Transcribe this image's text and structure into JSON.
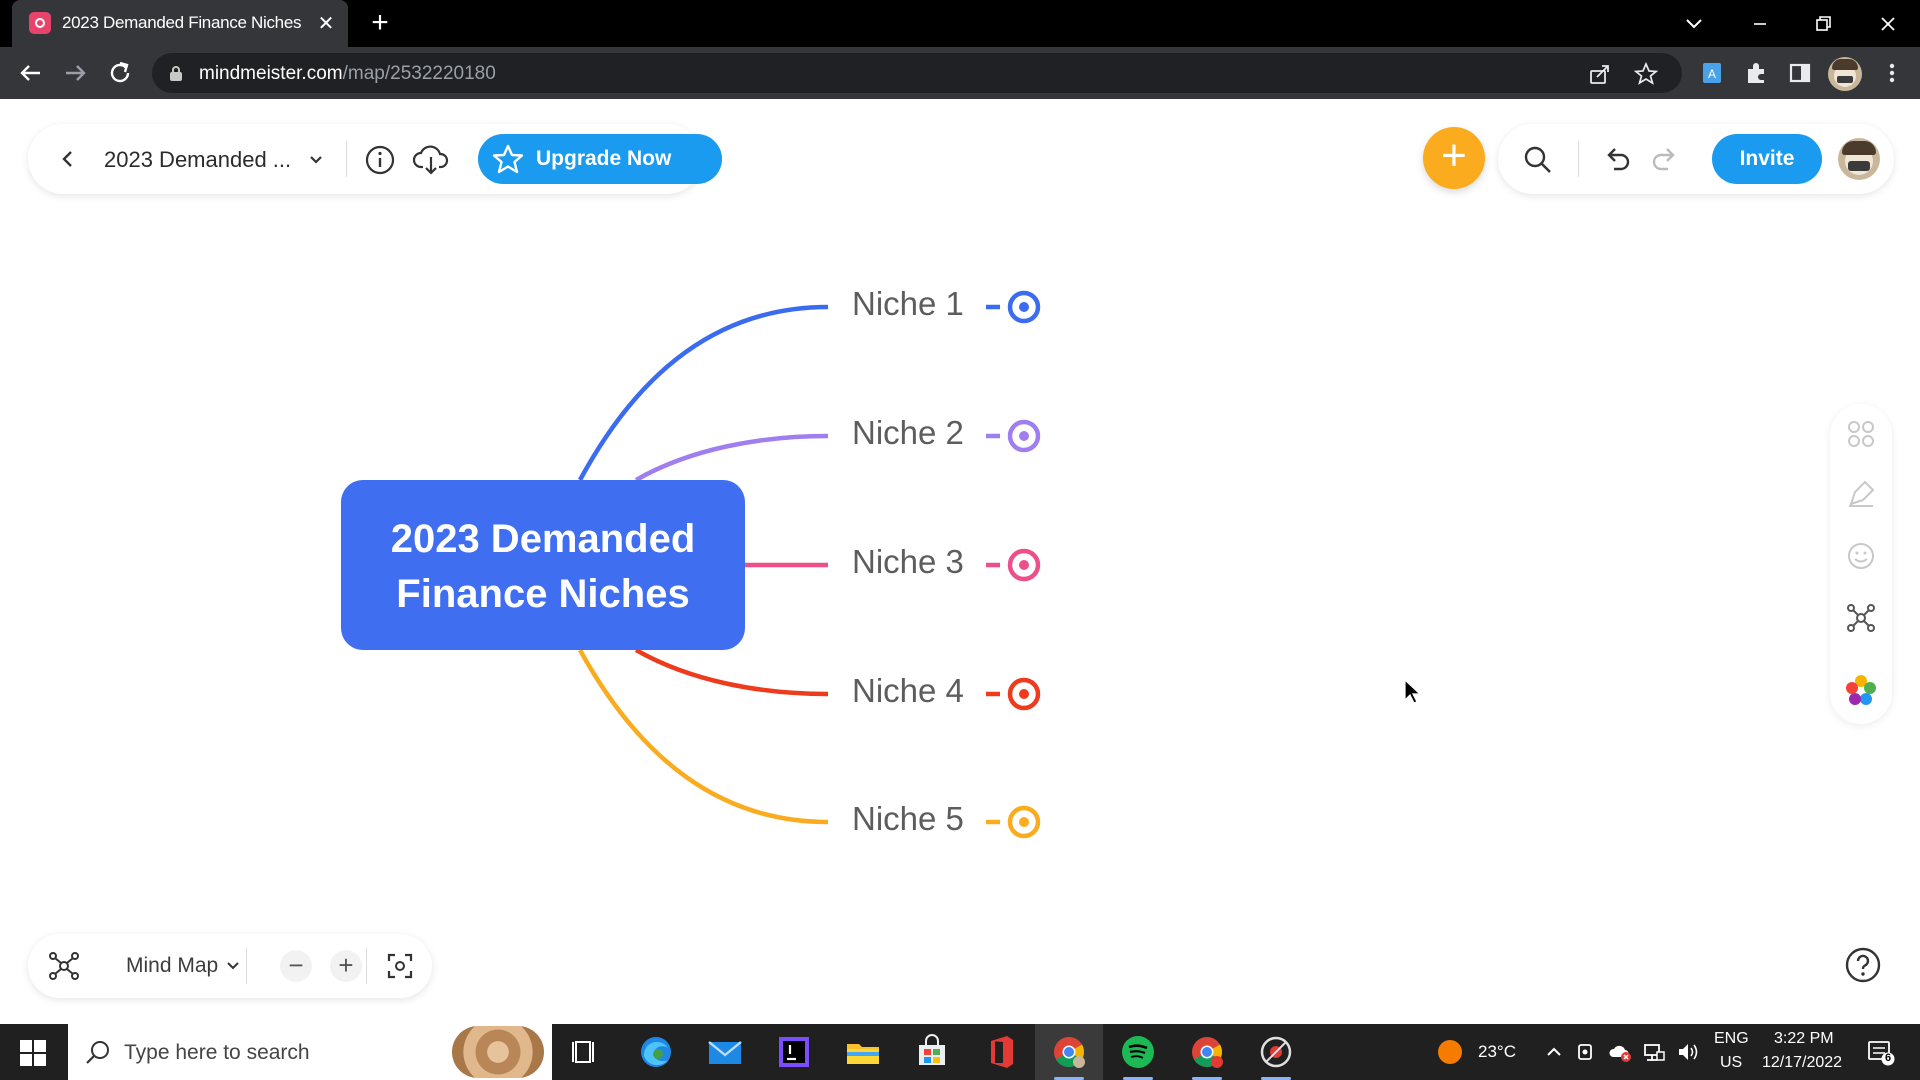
{
  "browser": {
    "tab_title": "2023 Demanded Finance Niches",
    "tab_close": "✕",
    "new_tab": "+",
    "url_domain": "mindmeister.com",
    "url_path": "/map/2532220180"
  },
  "toolbar": {
    "map_title": "2023 Demanded ...",
    "upgrade_label": "Upgrade Now",
    "add_label": "+",
    "invite_label": "Invite"
  },
  "mindmap": {
    "central": [
      "2023 Demanded",
      "Finance Niches"
    ],
    "central_color": "#3f6ef0",
    "branches": [
      {
        "label": "Niche 1",
        "color": "#3b6cf0"
      },
      {
        "label": "Niche 2",
        "color": "#a07ef0"
      },
      {
        "label": "Niche 3",
        "color": "#ec4f8a"
      },
      {
        "label": "Niche 4",
        "color": "#ee3b1d"
      },
      {
        "label": "Niche 5",
        "color": "#fbab1e"
      }
    ]
  },
  "bottom_controls": {
    "view_label": "Mind Map",
    "zoom_out": "−",
    "zoom_in": "+"
  },
  "taskbar": {
    "search_placeholder": "Type here to search",
    "weather": "23°C",
    "lang_top": "ENG",
    "lang_bottom": "US",
    "time": "3:22 PM",
    "date": "12/17/2022",
    "notification_count": "6"
  },
  "colors": {
    "accent_blue": "#1a9bf0",
    "add_orange": "#fbab1e"
  }
}
